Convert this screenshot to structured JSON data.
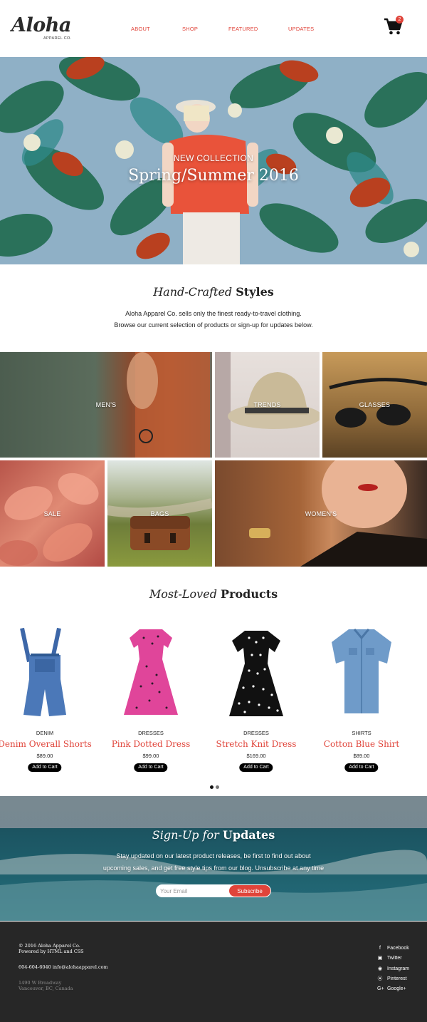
{
  "brand": {
    "name": "Aloha",
    "tagline": "APPAREL CO."
  },
  "nav": {
    "items": [
      "ABOUT",
      "SHOP",
      "FEATURED",
      "UPDATES"
    ]
  },
  "cart": {
    "count": "2"
  },
  "hero": {
    "eyebrow": "NEW COLLECTION",
    "title": "Spring/Summer 2016"
  },
  "intro": {
    "title_italic": "Hand-Crafted",
    "title_bold": "Styles",
    "line1": "Aloha Apparel Co. sells only the finest ready-to-travel clothing.",
    "line2": "Browse our current selection of products or sign-up for updates below."
  },
  "categories": [
    "MEN'S",
    "TRENDS",
    "GLASSES",
    "SALE",
    "BAGS",
    "WOMEN'S"
  ],
  "products_section": {
    "title_italic": "Most-Loved",
    "title_bold": "Products"
  },
  "products": [
    {
      "category": "DENIM",
      "name": "Denim Overall Shorts",
      "price": "$89.00",
      "button": "Add to Cart"
    },
    {
      "category": "DRESSES",
      "name": "Pink Dotted Dress",
      "price": "$99.00",
      "button": "Add to Cart"
    },
    {
      "category": "DRESSES",
      "name": "Stretch Knit Dress",
      "price": "$169.00",
      "button": "Add to Cart"
    },
    {
      "category": "SHIRTS",
      "name": "Cotton Blue Shirt",
      "price": "$89.00",
      "button": "Add to Cart"
    }
  ],
  "signup": {
    "title_italic": "Sign-Up for",
    "title_bold": "Updates",
    "line1": "Stay updated on our latest product releases, be first to find out about",
    "line2": "upcoming sales, and get free style tips from our blog. Unsubscribe at any time",
    "placeholder": "Your Email",
    "button": "Subscribe"
  },
  "footer": {
    "copyright": "© 2016 Aloha Apparel Co.",
    "powered": "Powered by HTML and CSS",
    "contact": "604-604-6040 info@alohaapparel.com",
    "address1": "1490 W Broadway",
    "address2": "Vancouver, BC, Canada",
    "social": [
      {
        "icon": "facebook-icon",
        "label": "Facebook"
      },
      {
        "icon": "twitter-icon",
        "label": "Twitter"
      },
      {
        "icon": "instagram-icon",
        "label": "Instagram"
      },
      {
        "icon": "pinterest-icon",
        "label": "Pinterest"
      },
      {
        "icon": "google-plus-icon",
        "label": "Google+"
      }
    ]
  },
  "colors": {
    "accent": "#e0443a",
    "footer_bg": "#272727",
    "button_black": "#000000"
  }
}
